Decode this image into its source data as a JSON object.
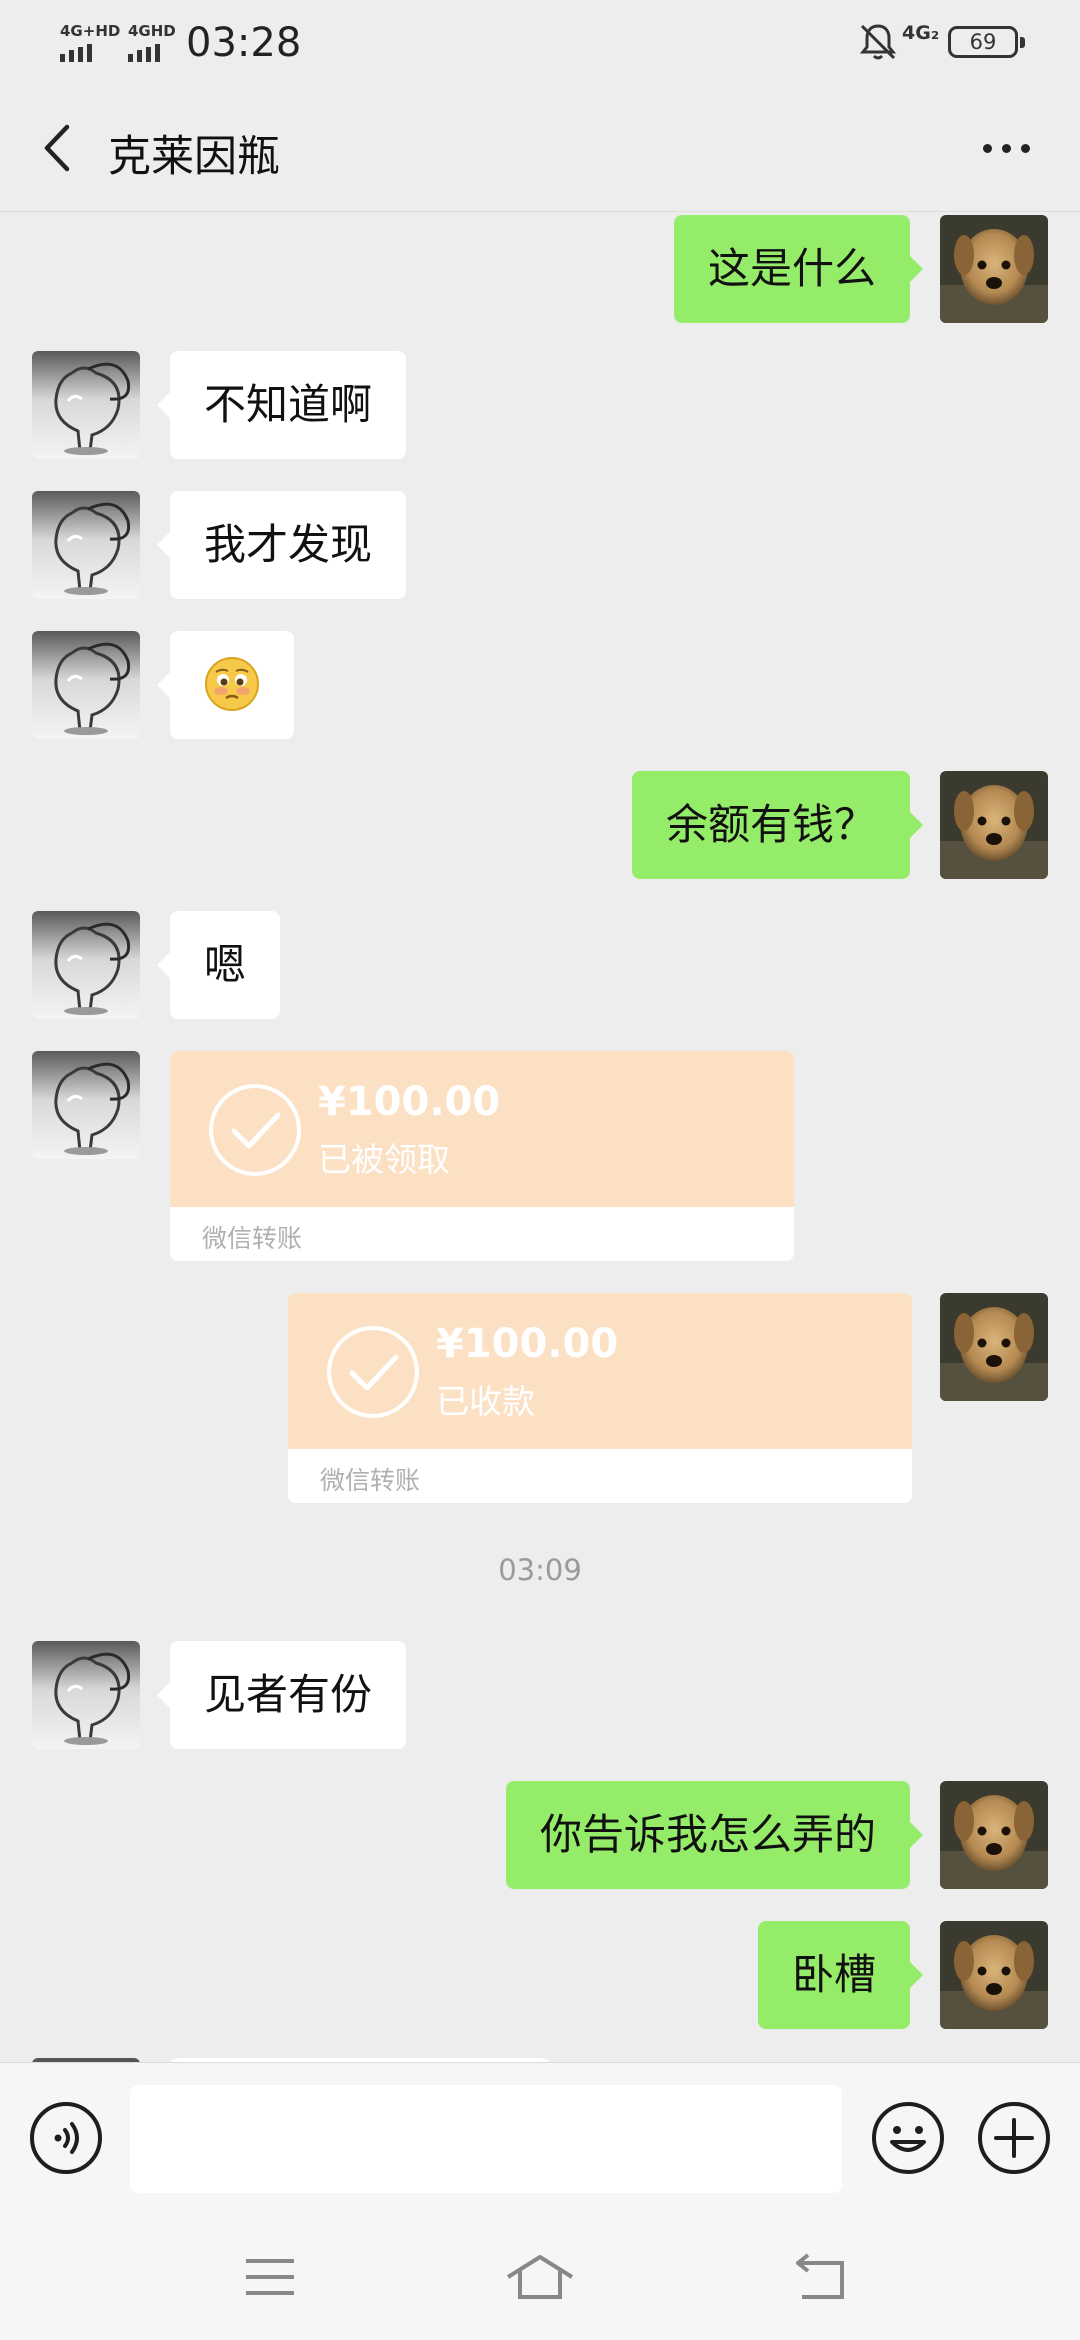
{
  "status_bar": {
    "sim1": "4G+HD",
    "sim2": "4GHD",
    "time": "03:28",
    "network": "4G₂",
    "battery": "69"
  },
  "header": {
    "title": "克莱因瓶",
    "back_icon": "chevron-left-icon",
    "more_icon": "more-horizontal-icon"
  },
  "messages": [
    {
      "direction": "out",
      "text": "这是什么"
    },
    {
      "direction": "in",
      "text": "不知道啊"
    },
    {
      "direction": "in",
      "text": "我才发现"
    },
    {
      "direction": "in",
      "emoji": "woozy-face-emoji"
    },
    {
      "direction": "out",
      "text": "余额有钱？"
    },
    {
      "direction": "in",
      "text": "嗯"
    },
    {
      "direction": "in",
      "transfer": {
        "amount": "¥100.00",
        "status": "已被领取",
        "service": "微信转账"
      }
    },
    {
      "direction": "out",
      "transfer": {
        "amount": "¥100.00",
        "status": "已收款",
        "service": "微信转账"
      }
    },
    {
      "timestamp": "03:09"
    },
    {
      "direction": "in",
      "text": "见者有份"
    },
    {
      "direction": "out",
      "text": "你告诉我怎么弄的"
    },
    {
      "direction": "out",
      "text": "卧槽"
    }
  ],
  "input_bar": {
    "voice_icon": "voice-icon",
    "message_value": "",
    "emoji_icon": "smiley-icon",
    "more_icon": "plus-circle-icon"
  },
  "nav_bar": {
    "menu_icon": "menu-icon",
    "home_icon": "home-icon",
    "back_icon": "back-arrow-icon"
  },
  "colors": {
    "background": "#ededed",
    "outgoing_bubble": "#95ec69",
    "incoming_bubble": "#ffffff",
    "transfer_card": "#fce0c4",
    "timestamp_text": "#9b9b9b"
  }
}
